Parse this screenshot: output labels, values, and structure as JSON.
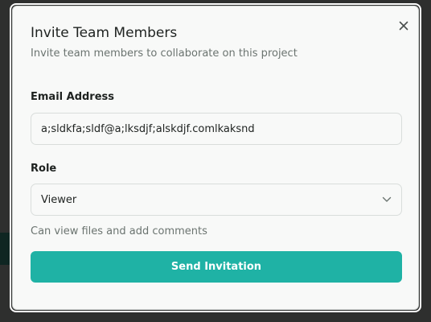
{
  "dialog": {
    "title": "Invite Team Members",
    "subtitle": "Invite team members to collaborate on this project",
    "close_icon": "close-icon"
  },
  "email": {
    "label": "Email Address",
    "value": "a;sldkfa;sldf@a;lksdjf;alskdjf.comlkaksnd"
  },
  "role": {
    "label": "Role",
    "selected": "Viewer",
    "icon": "chevron-down-icon",
    "helper": "Can view files and add comments"
  },
  "submit": {
    "label": "Send Invitation"
  },
  "colors": {
    "accent": "#1fb2a5",
    "surface": "#f8f9f8",
    "text": "#1e2220",
    "muted": "#6b7470"
  }
}
